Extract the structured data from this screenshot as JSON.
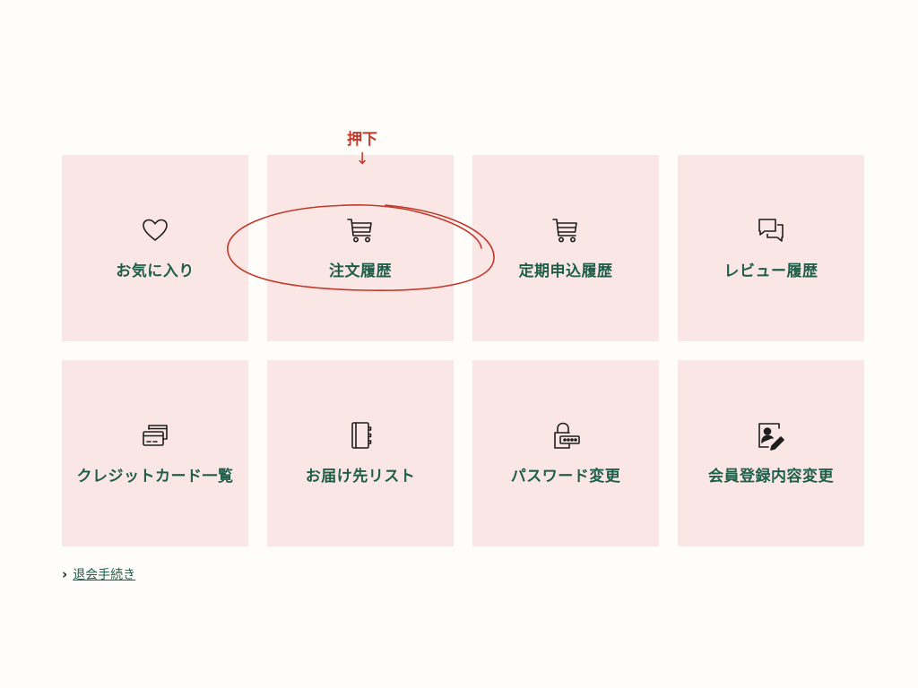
{
  "menu": {
    "tiles": [
      {
        "label": "お気に入り",
        "icon": "heart-icon"
      },
      {
        "label": "注文履歴",
        "icon": "cart-icon"
      },
      {
        "label": "定期申込履歴",
        "icon": "cart-icon"
      },
      {
        "label": "レビュー履歴",
        "icon": "chat-bubbles-icon"
      },
      {
        "label": "クレジットカード一覧",
        "icon": "credit-card-icon"
      },
      {
        "label": "お届け先リスト",
        "icon": "address-book-icon"
      },
      {
        "label": "パスワード変更",
        "icon": "lock-password-icon"
      },
      {
        "label": "会員登録内容変更",
        "icon": "profile-edit-icon"
      }
    ]
  },
  "withdraw": {
    "label": "退会手続き"
  },
  "annotation": {
    "text": "押下",
    "arrow": "↓"
  },
  "colors": {
    "background": "#fffdf9",
    "tile": "#fae6e4",
    "label": "#1f5e4a",
    "annotation": "#c0392b"
  }
}
